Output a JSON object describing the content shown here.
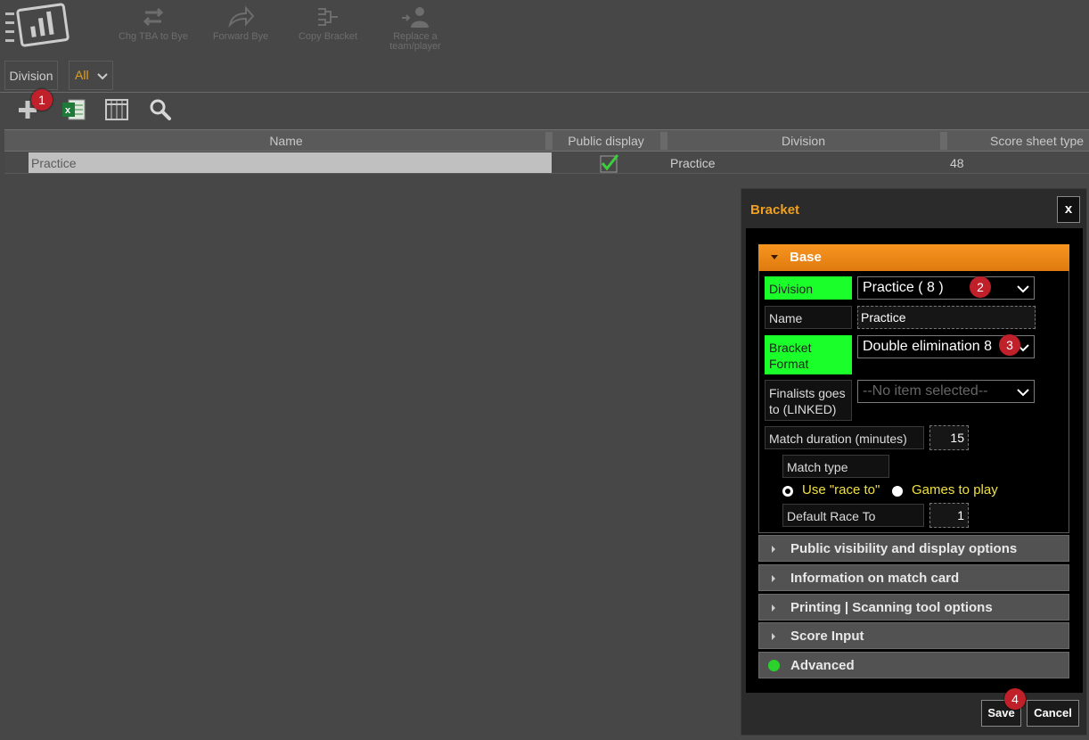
{
  "toolbar": {
    "chg_tba": "Chg TBA to Bye",
    "forward_bye": "Forward Bye",
    "copy_bracket": "Copy Bracket",
    "replace_line1": "Replace a",
    "replace_line2": "team/player"
  },
  "filter": {
    "division_label": "Division",
    "division_value": "All"
  },
  "table": {
    "headers": [
      "Name",
      "Public display",
      "Division",
      "Score sheet type"
    ],
    "rows": [
      {
        "name": "Practice",
        "public_display": true,
        "division": "Practice",
        "score_sheet_type": "48"
      }
    ]
  },
  "badges": [
    "1",
    "2",
    "3",
    "4"
  ],
  "dialog": {
    "title": "Bracket",
    "close": "x",
    "base": {
      "header": "Base",
      "division_label": "Division",
      "division_value": "Practice ( 8 )",
      "name_label": "Name",
      "name_value": "Practice",
      "bracket_format_label_1": "Bracket",
      "bracket_format_label_2": "Format",
      "bracket_format_value": "Double elimination 8",
      "finalists_label_1": "Finalists goes",
      "finalists_label_2": "to (LINKED)",
      "finalists_placeholder": "--No item selected--",
      "match_duration_label": "Match duration (minutes)",
      "match_duration_value": "15",
      "match_type_label": "Match type",
      "race_to_option": "Use \"race to\"",
      "games_option": "Games to play",
      "default_race_label": "Default Race To",
      "default_race_value": "1"
    },
    "sections": [
      "Public visibility and display options",
      "Information on match card",
      "Printing | Scanning tool options",
      "Score Input",
      "Advanced"
    ],
    "save": "Save",
    "cancel": "Cancel"
  },
  "colors": {
    "accent": "#f0a020",
    "required": "#1aff2a",
    "badge": "#c0202a"
  }
}
